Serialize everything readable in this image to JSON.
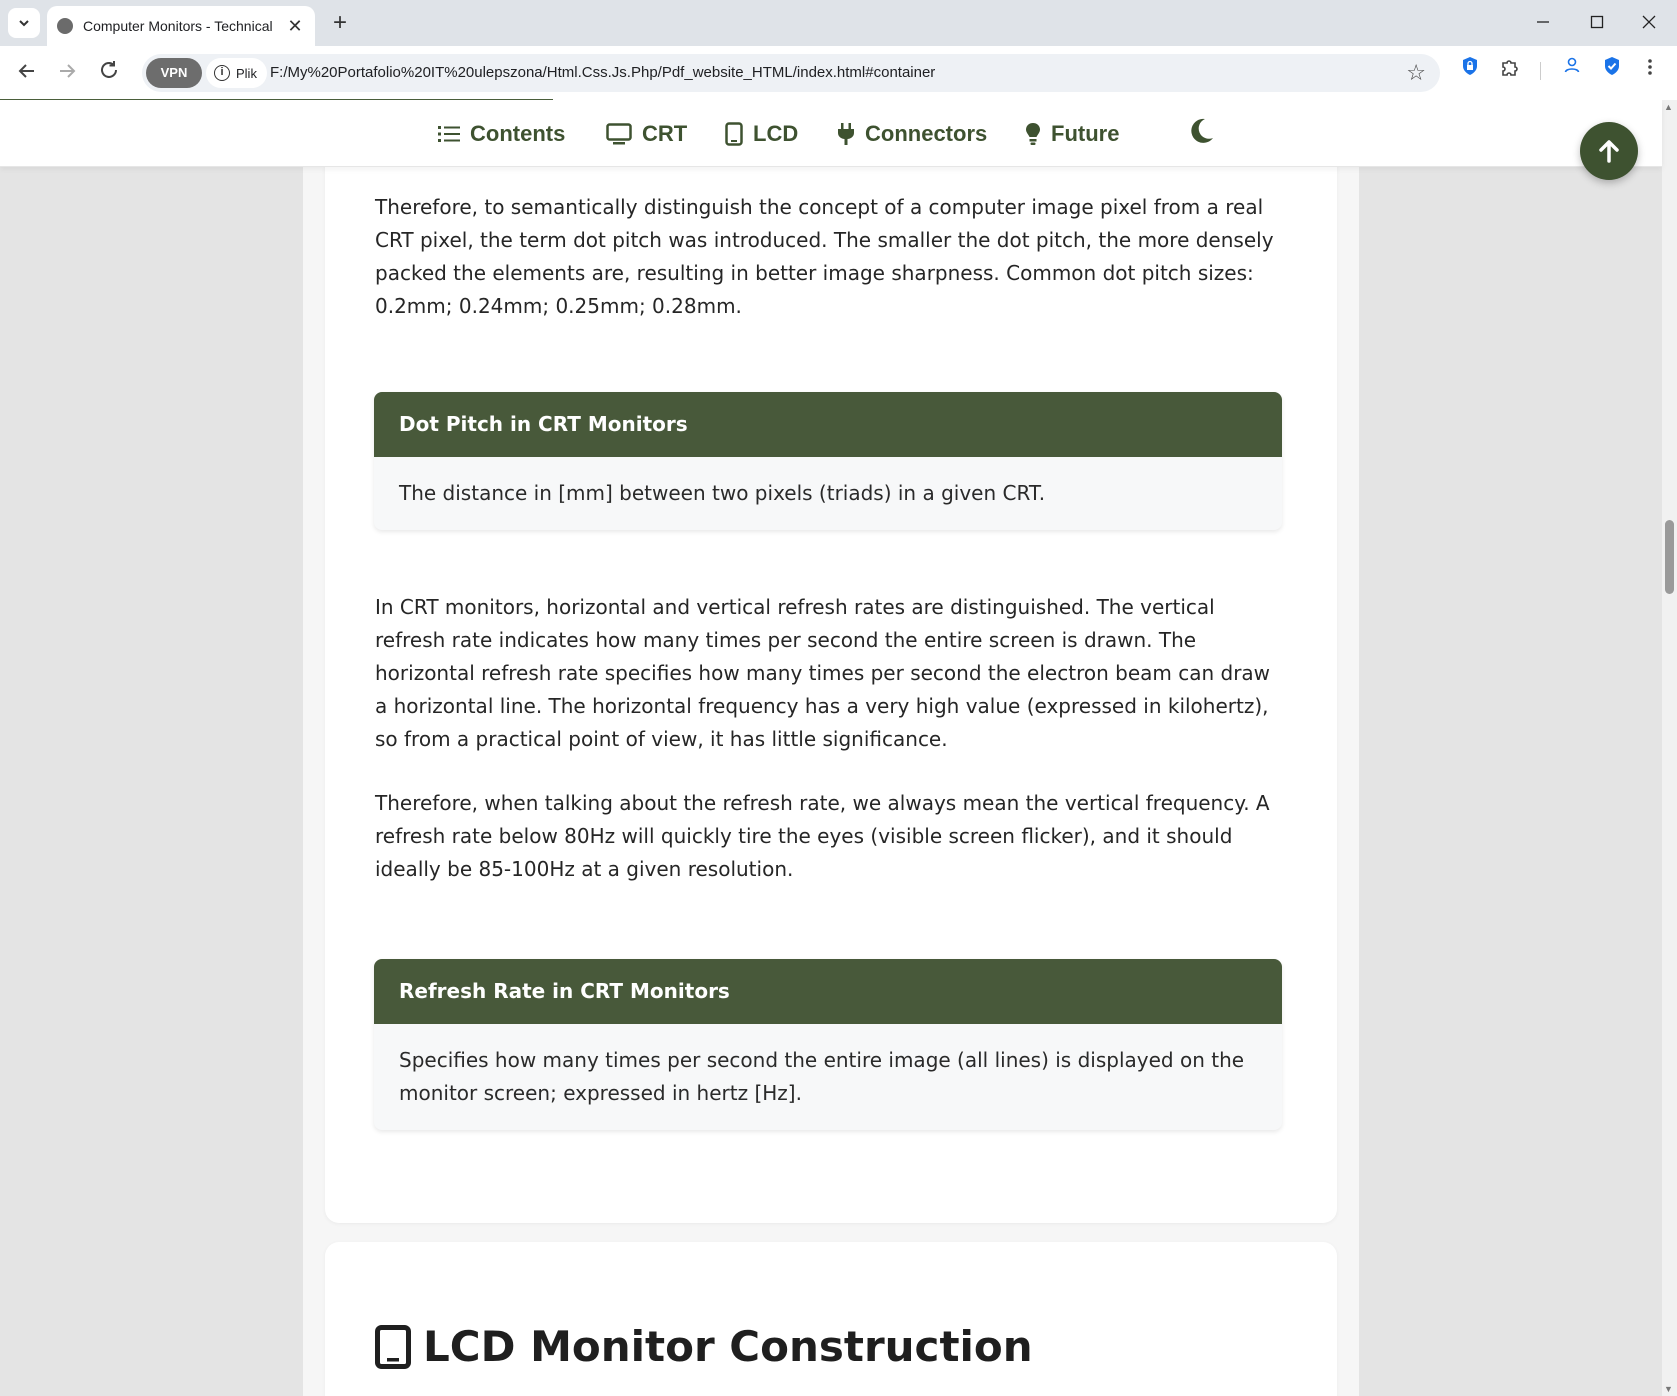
{
  "browser": {
    "tab_title": "Computer Monitors - Technical Ov",
    "tab_favicon": "globe-icon",
    "new_tab": "+",
    "vpn_label": "VPN",
    "site_info_label": "Plik",
    "url": "F:/My%20Portafolio%20IT%20ulepszona/Html.Css.Js.Php/Pdf_website_HTML/index.html#container",
    "page_load_progress": 0.33
  },
  "nav": {
    "items": [
      {
        "label": "Contents",
        "icon": "list-icon"
      },
      {
        "label": "CRT",
        "icon": "desktop-icon"
      },
      {
        "label": "LCD",
        "icon": "tablet-icon"
      },
      {
        "label": "Connectors",
        "icon": "plug-icon"
      },
      {
        "label": "Future",
        "icon": "lightbulb-icon"
      }
    ],
    "theme_toggle_icon": "moon-icon",
    "back_to_top_icon": "arrow-up-icon"
  },
  "content": {
    "para1": "Therefore, to semantically distinguish the concept of a computer image pixel from a real CRT pixel, the term dot pitch was introduced. The smaller the dot pitch, the more densely packed the elements are, resulting in better image sharpness. Common dot pitch sizes: 0.2mm; 0.24mm; 0.25mm; 0.28mm.",
    "def1": {
      "title": "Dot Pitch in CRT Monitors",
      "body": "The distance in [mm] between two pixels (triads) in a given CRT."
    },
    "para2": "In CRT monitors, horizontal and vertical refresh rates are distinguished. The vertical refresh rate indicates how many times per second the entire screen is drawn. The horizontal refresh rate specifies how many times per second the electron beam can draw a horizontal line. The horizontal frequency has a very high value (expressed in kilohertz), so from a practical point of view, it has little significance.",
    "para3": "Therefore, when talking about the refresh rate, we always mean the vertical frequency. A refresh rate below 80Hz will quickly tire the eyes (visible screen flicker), and it should ideally be 85-100Hz at a given resolution.",
    "def2": {
      "title": "Refresh Rate in CRT Monitors",
      "body": "Specifies how many times per second the entire image (all lines) is displayed on the monitor screen; expressed in hertz [Hz]."
    },
    "section2_title": "LCD Monitor Construction",
    "section2_icon": "tablet-icon"
  },
  "colors": {
    "accent": "#48593a",
    "nav_text": "#3e5230"
  }
}
